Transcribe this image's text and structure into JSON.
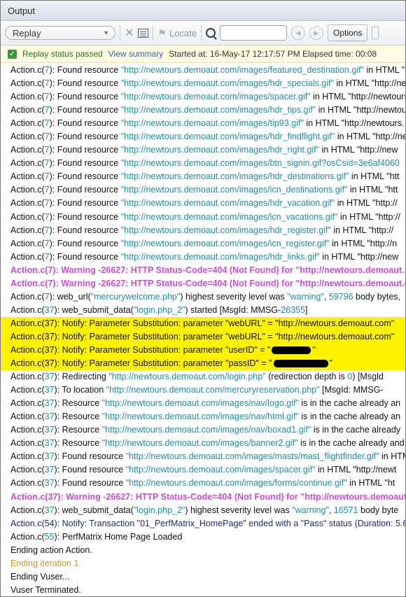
{
  "window": {
    "title": "Output"
  },
  "toolbar": {
    "dropdown_value": "Replay",
    "locate_label": "Locate",
    "search_placeholder": "",
    "options_label": "Options"
  },
  "status_bar": {
    "message": "Replay status passed",
    "view_summary": "View summary",
    "started_at": "Started at: 16-May-17 12:17:57 PM Elapsed time: 00:08"
  },
  "colors": {
    "highlight": "#fff200",
    "warning": "#c84fd6",
    "url": "#1e8ea6"
  },
  "log": [
    {
      "parts": [
        [
          "",
          "Action.c("
        ],
        [
          "num",
          "7"
        ],
        [
          "",
          "): Found resource "
        ],
        [
          "url",
          "\"http://newtours.demoaut.com/images/featured_destination.gif\""
        ],
        [
          "",
          " in HTML \"http://"
        ]
      ]
    },
    {
      "parts": [
        [
          "",
          "Action.c("
        ],
        [
          "num",
          "7"
        ],
        [
          "",
          "): Found resource "
        ],
        [
          "url",
          "\"http://newtours.demoaut.com/images/hdr_specials.gif\""
        ],
        [
          "",
          " in HTML \"http://newto"
        ]
      ]
    },
    {
      "parts": [
        [
          "",
          "Action.c("
        ],
        [
          "num",
          "7"
        ],
        [
          "",
          "): Found resource "
        ],
        [
          "url",
          "\"http://newtours.demoaut.com/images/spacer.gif\""
        ],
        [
          "",
          " in HTML \"http://newtours."
        ]
      ]
    },
    {
      "parts": [
        [
          "",
          "Action.c("
        ],
        [
          "num",
          "7"
        ],
        [
          "",
          "): Found resource "
        ],
        [
          "url",
          "\"http://newtours.demoaut.com/images/hdr_tips.gif\""
        ],
        [
          "",
          " in HTML \"http://newtou"
        ]
      ]
    },
    {
      "parts": [
        [
          "",
          "Action.c("
        ],
        [
          "num",
          "7"
        ],
        [
          "",
          "): Found resource "
        ],
        [
          "url",
          "\"http://newtours.demoaut.com/images/tip93.gif\""
        ],
        [
          "",
          " in HTML \"http://newtours."
        ]
      ]
    },
    {
      "parts": [
        [
          "",
          "Action.c("
        ],
        [
          "num",
          "7"
        ],
        [
          "",
          "): Found resource "
        ],
        [
          "url",
          "\"http://newtours.demoaut.com/images/hdr_findflight.gif\""
        ],
        [
          "",
          " in HTML \"http://ne"
        ]
      ]
    },
    {
      "parts": [
        [
          "",
          "Action.c("
        ],
        [
          "num",
          "7"
        ],
        [
          "",
          "): Found resource "
        ],
        [
          "url",
          "\"http://newtours.demoaut.com/images/hdr_right.gif\""
        ],
        [
          "",
          " in HTML \"http://new"
        ]
      ]
    },
    {
      "parts": [
        [
          "",
          "Action.c("
        ],
        [
          "num",
          "7"
        ],
        [
          "",
          "): Found resource "
        ],
        [
          "url",
          "\"http://newtours.demoaut.com/images/btn_signin.gif?osCsid=3e6af4060"
        ]
      ]
    },
    {
      "parts": [
        [
          "",
          "Action.c("
        ],
        [
          "num",
          "7"
        ],
        [
          "",
          "): Found resource "
        ],
        [
          "url",
          "\"http://newtours.demoaut.com/images/hdr_destinations.gif\""
        ],
        [
          "",
          " in HTML \"htt"
        ]
      ]
    },
    {
      "parts": [
        [
          "",
          "Action.c("
        ],
        [
          "num",
          "7"
        ],
        [
          "",
          "): Found resource "
        ],
        [
          "url",
          "\"http://newtours.demoaut.com/images/icn_destinations.gif\""
        ],
        [
          "",
          " in HTML \"htt"
        ]
      ]
    },
    {
      "parts": [
        [
          "",
          "Action.c("
        ],
        [
          "num",
          "7"
        ],
        [
          "",
          "): Found resource "
        ],
        [
          "url",
          "\"http://newtours.demoaut.com/images/hdr_vacation.gif\""
        ],
        [
          "",
          " in HTML \"http://"
        ]
      ]
    },
    {
      "parts": [
        [
          "",
          "Action.c("
        ],
        [
          "num",
          "7"
        ],
        [
          "",
          "): Found resource "
        ],
        [
          "url",
          "\"http://newtours.demoaut.com/images/icn_vacations.gif\""
        ],
        [
          "",
          " in HTML \"http://"
        ]
      ]
    },
    {
      "parts": [
        [
          "",
          "Action.c("
        ],
        [
          "num",
          "7"
        ],
        [
          "",
          "): Found resource "
        ],
        [
          "url",
          "\"http://newtours.demoaut.com/images/hdr_register.gif\""
        ],
        [
          "",
          " in HTML \"http://"
        ]
      ]
    },
    {
      "parts": [
        [
          "",
          "Action.c("
        ],
        [
          "num",
          "7"
        ],
        [
          "",
          "): Found resource "
        ],
        [
          "url",
          "\"http://newtours.demoaut.com/images/icn_register.gif\""
        ],
        [
          "",
          " in HTML \"http://n"
        ]
      ]
    },
    {
      "parts": [
        [
          "",
          "Action.c("
        ],
        [
          "num",
          "7"
        ],
        [
          "",
          "): Found resource "
        ],
        [
          "url",
          "\"http://newtours.demoaut.com/images/hdr_links.gif\""
        ],
        [
          "",
          " in HTML \"http://new"
        ]
      ]
    },
    {
      "parts": [
        [
          "warn",
          "Action.c(7): Warning -26627: HTTP Status-Code=404 (Not Found) for \"http://newtours.demoaut."
        ]
      ]
    },
    {
      "parts": [
        [
          "warn",
          "Action.c(7): Warning -26627: HTTP Status-Code=404 (Not Found) for \"http://newtours.demoaut.com"
        ]
      ]
    },
    {
      "parts": [
        [
          "",
          "Action.c("
        ],
        [
          "num",
          "7"
        ],
        [
          "",
          "): web_url("
        ],
        [
          "url",
          "\"mercurywelcome.php\""
        ],
        [
          "",
          ") highest severity level was "
        ],
        [
          "url",
          "\"warning\""
        ],
        [
          "",
          ", "
        ],
        [
          "num",
          "59796"
        ],
        [
          "",
          " body bytes,"
        ]
      ]
    },
    {
      "parts": [
        [
          "",
          "Action.c("
        ],
        [
          "num",
          "37"
        ],
        [
          "",
          "): web_submit_data("
        ],
        [
          "url",
          "\"login.php_2\""
        ],
        [
          "",
          ") started    [MsgId: MMSG-"
        ],
        [
          "num",
          "26355"
        ],
        [
          "",
          "]"
        ]
      ]
    },
    {
      "hl": true,
      "parts": [
        [
          "",
          "Action.c(37): Notify: Parameter Substitution: parameter \"webURL\" =  \"http://newtours.demoaut.com\""
        ]
      ]
    },
    {
      "hl": true,
      "parts": [
        [
          "",
          "Action.c(37): Notify: Parameter Substitution: parameter \"webURL\" =  \"http://newtours.demoaut.com\""
        ]
      ]
    },
    {
      "hl": true,
      "redact": "short",
      "parts": [
        [
          "",
          "Action.c(37): Notify: Parameter Substitution: parameter \"userID\" =  \""
        ],
        [
          "redact",
          ""
        ],
        [
          "",
          "\""
        ]
      ]
    },
    {
      "hl": true,
      "redact": "long",
      "parts": [
        [
          "",
          "Action.c(37): Notify: Parameter Substitution: parameter \"passID\" =  \""
        ],
        [
          "redact",
          ""
        ],
        [
          "",
          "\""
        ]
      ]
    },
    {
      "parts": [
        [
          "",
          "Action.c("
        ],
        [
          "num",
          "37"
        ],
        [
          "",
          "): Redirecting "
        ],
        [
          "url",
          "\"http://newtours.demoaut.com/login.php\""
        ],
        [
          "",
          " (redirection depth is "
        ],
        [
          "num",
          "0"
        ],
        [
          "",
          ")       [Msgld"
        ]
      ]
    },
    {
      "parts": [
        [
          "",
          "Action.c("
        ],
        [
          "num",
          "37"
        ],
        [
          "",
          "): To location "
        ],
        [
          "url",
          "\"http://newtours.demoaut.com/mercuryreservation.php\""
        ],
        [
          "",
          "        [MsgId: MMSG-"
        ]
      ]
    },
    {
      "parts": [
        [
          "",
          "Action.c("
        ],
        [
          "num",
          "37"
        ],
        [
          "",
          "): Resource "
        ],
        [
          "url",
          "\"http://newtours.demoaut.com/images/nav/logo.gif\""
        ],
        [
          "",
          " is in the cache already an"
        ]
      ]
    },
    {
      "parts": [
        [
          "",
          "Action.c("
        ],
        [
          "num",
          "37"
        ],
        [
          "",
          "): Resource "
        ],
        [
          "url",
          "\"http://newtours.demoaut.com/images/nav/html.gif\""
        ],
        [
          "",
          " is in the cache already an"
        ]
      ]
    },
    {
      "parts": [
        [
          "",
          "Action.c("
        ],
        [
          "num",
          "37"
        ],
        [
          "",
          "): Resource "
        ],
        [
          "url",
          "\"http://newtours.demoaut.com/images/nav/boxad1.gif\""
        ],
        [
          "",
          " is in the cache already"
        ]
      ]
    },
    {
      "parts": [
        [
          "",
          "Action.c("
        ],
        [
          "num",
          "37"
        ],
        [
          "",
          "): Resource "
        ],
        [
          "url",
          "\"http://newtours.demoaut.com/images/banner2.gif\""
        ],
        [
          "",
          " is in the cache already and"
        ]
      ]
    },
    {
      "parts": [
        [
          "",
          "Action.c("
        ],
        [
          "num",
          "37"
        ],
        [
          "",
          "): Found resource "
        ],
        [
          "url",
          "\"http://newtours.demoaut.com/images/masts/mast_flightfinder.gif\""
        ],
        [
          "",
          " in HTM"
        ]
      ]
    },
    {
      "parts": [
        [
          "",
          "Action.c("
        ],
        [
          "num",
          "37"
        ],
        [
          "",
          "): Found resource "
        ],
        [
          "url",
          "\"http://newtours.demoaut.com/images/spacer.gif\""
        ],
        [
          "",
          " in HTML \"http://newt"
        ]
      ]
    },
    {
      "parts": [
        [
          "",
          "Action.c("
        ],
        [
          "num",
          "37"
        ],
        [
          "",
          "): Found resource "
        ],
        [
          "url",
          "\"http://newtours.demoaut.com/images/forms/continue.gif\""
        ],
        [
          "",
          " in HTML \"ht"
        ]
      ]
    },
    {
      "parts": [
        [
          "warn",
          "Action.c(37): Warning -26627: HTTP Status-Code=404 (Not Found) for \"http://newtours.demoaut.com"
        ]
      ]
    },
    {
      "parts": [
        [
          "",
          "Action.c("
        ],
        [
          "num",
          "37"
        ],
        [
          "",
          "): web_submit_data("
        ],
        [
          "url",
          "\"login.php_2\""
        ],
        [
          "",
          ") highest severity level was "
        ],
        [
          "url",
          "\"warning\""
        ],
        [
          "",
          ", "
        ],
        [
          "num",
          "16571"
        ],
        [
          "",
          " body byte"
        ]
      ]
    },
    {
      "parts": [
        [
          "notify",
          "Action.c(54): Notify: Transaction \"01_PerfMatrix_HomePage\" ended with a \"Pass\" status (Duration: 5.6"
        ]
      ]
    },
    {
      "parts": [
        [
          "",
          "Action.c("
        ],
        [
          "num",
          "55"
        ],
        [
          "",
          "): PerfMatrix Home Page Loaded"
        ]
      ]
    },
    {
      "parts": [
        [
          "",
          "Ending action Action."
        ]
      ]
    },
    {
      "parts": [
        [
          "grey",
          "Ending iteration 1."
        ]
      ]
    },
    {
      "parts": [
        [
          "",
          "Ending Vuser..."
        ]
      ]
    },
    {
      "parts": [
        [
          "",
          "Vuser Terminated."
        ]
      ]
    }
  ]
}
